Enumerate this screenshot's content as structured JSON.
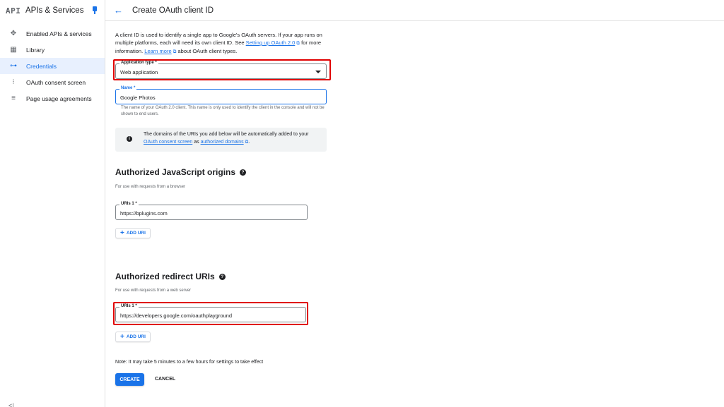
{
  "sidebar": {
    "logo": "API",
    "title": "APIs & Services",
    "items": [
      {
        "label": "Enabled APIs & services",
        "icon": "apis-icon"
      },
      {
        "label": "Library",
        "icon": "library-icon"
      },
      {
        "label": "Credentials",
        "icon": "key-icon",
        "active": true
      },
      {
        "label": "OAuth consent screen",
        "icon": "consent-icon"
      },
      {
        "label": "Page usage agreements",
        "icon": "settings-list-icon"
      }
    ],
    "collapse_label": "<|"
  },
  "header": {
    "title": "Create OAuth client ID"
  },
  "intro": {
    "part1": "A client ID is used to identify a single app to Google's OAuth servers. If your app runs on multiple platforms, each will need its own client ID. See ",
    "link1": "Setting up OAuth 2.0",
    "part2": " for more information. ",
    "link2": "Learn more",
    "part3": " about OAuth client types."
  },
  "application_type": {
    "label": "Application type *",
    "value": "Web application"
  },
  "name_field": {
    "label": "Name *",
    "value": "Google Photos",
    "help": "The name of your OAuth 2.0 client. This name is only used to identify the client in the console and will not be shown to end users."
  },
  "info": {
    "part1": "The domains of the URIs you add below will be automatically added to your ",
    "link1": "OAuth consent screen",
    "part2": " as ",
    "link2": "authorized domains",
    "part3": "."
  },
  "js_origins": {
    "heading": "Authorized JavaScript origins",
    "subtitle": "For use with requests from a browser",
    "uri_label": "URIs 1 *",
    "uri_value": "https://bplugins.com",
    "add_label": "ADD URI"
  },
  "redirect_uris": {
    "heading": "Authorized redirect URIs",
    "subtitle": "For use with requests from a web server",
    "uri_label": "URIs 1 *",
    "uri_value": "https://developers.google.com/oauthplayground",
    "add_label": "ADD URI"
  },
  "footer": {
    "note": "Note: It may take 5 minutes to a few hours for settings to take effect",
    "create_label": "CREATE",
    "cancel_label": "CANCEL"
  },
  "colors": {
    "accent": "#1a73e8",
    "highlight": "#e00000",
    "active_bg": "#e8f0fe"
  }
}
